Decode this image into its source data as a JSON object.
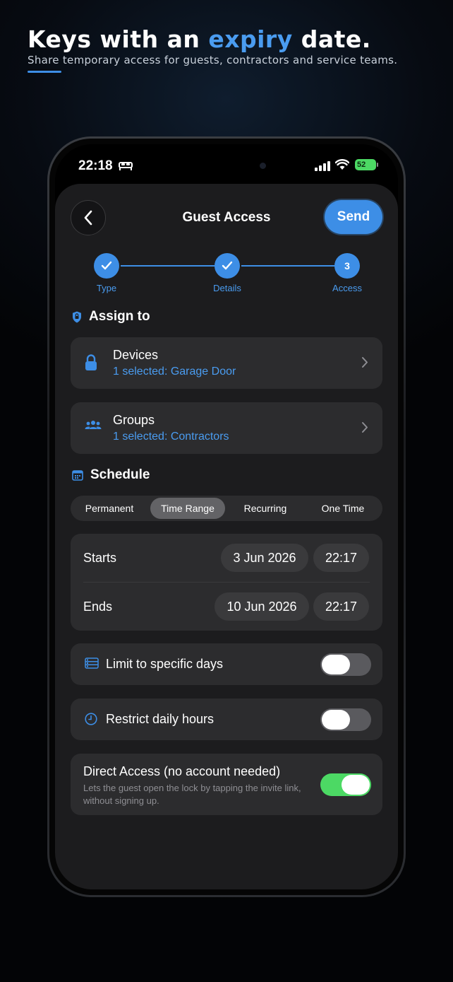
{
  "promo": {
    "headline_pre": "Keys with an ",
    "headline_accent": "expiry",
    "headline_post": " date.",
    "subtitle": "Share temporary access for guests, contractors and service teams."
  },
  "status_bar": {
    "time": "22:18",
    "battery": "52"
  },
  "header": {
    "title": "Guest Access",
    "send_label": "Send"
  },
  "stepper": {
    "steps": [
      {
        "label": "Type",
        "state": "done"
      },
      {
        "label": "Details",
        "state": "done"
      },
      {
        "label": "Access",
        "number": "3",
        "state": "current"
      }
    ]
  },
  "assign": {
    "heading": "Assign to",
    "devices": {
      "title": "Devices",
      "subtitle": "1 selected: Garage Door"
    },
    "groups": {
      "title": "Groups",
      "subtitle": "1 selected: Contractors"
    }
  },
  "schedule": {
    "heading": "Schedule",
    "tabs": [
      "Permanent",
      "Time Range",
      "Recurring",
      "One Time"
    ],
    "active_tab": "Time Range",
    "starts": {
      "label": "Starts",
      "date": "3 Jun 2026",
      "time": "22:17"
    },
    "ends": {
      "label": "Ends",
      "date": "10 Jun 2026",
      "time": "22:17"
    }
  },
  "options": {
    "limit_days": {
      "label": "Limit to specific days",
      "enabled": false
    },
    "daily_hours": {
      "label": "Restrict daily hours",
      "enabled": false
    },
    "direct_access": {
      "title": "Direct Access (no account needed)",
      "description": "Lets the guest open the lock by tapping the invite link, without signing up.",
      "enabled": true
    }
  },
  "colors": {
    "accent": "#3d8ee6",
    "toggle_on": "#4cd964",
    "card": "#2c2c2e",
    "sheet": "#1c1c1e"
  },
  "icons": [
    "bed-icon",
    "signal-icon",
    "wifi-icon",
    "battery-icon",
    "back-arrow-icon",
    "check-icon",
    "shield-icon",
    "lock-icon",
    "people-icon",
    "chevron-right-icon",
    "calendar-icon",
    "list-icon",
    "clock-icon"
  ]
}
